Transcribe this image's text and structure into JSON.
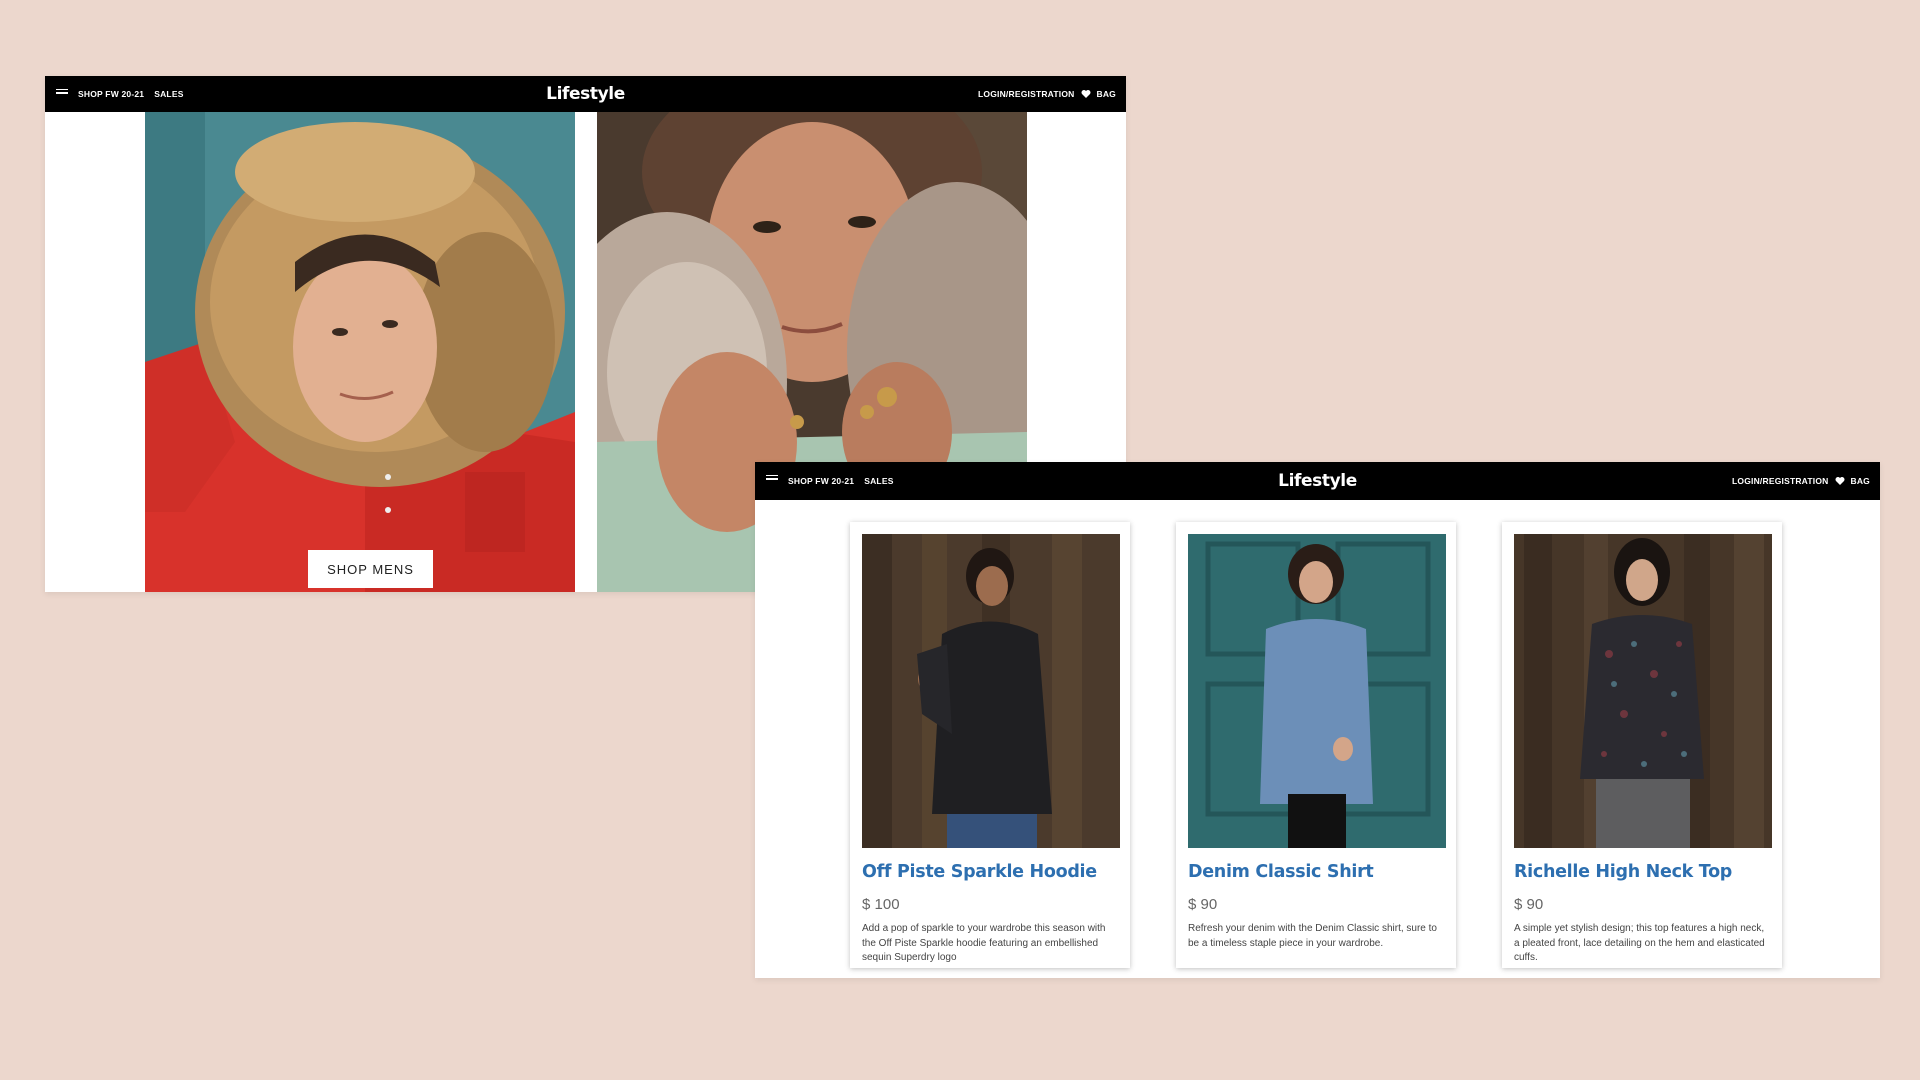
{
  "header": {
    "nav_shop": "SHOP FW 20-21",
    "nav_sales": "SALES",
    "brand": "Lifestyle",
    "login": "LOGIN/REGISTRATION",
    "bag": "BAG",
    "menu_icon": "hamburger-menu-icon",
    "heart_icon": "heart-icon"
  },
  "hero": {
    "shop_button": "SHOP MENS"
  },
  "products": [
    {
      "title": "Off Piste Sparkle Hoodie",
      "price": "$ 100",
      "description": "Add a pop of sparkle to your wardrobe this season with the Off Piste Sparkle hoodie featuring an embellished sequin Superdry logo"
    },
    {
      "title": "Denim Classic Shirt",
      "price": "$ 90",
      "description": "Refresh your denim with the Denim Classic shirt, sure to be a timeless staple piece in your wardrobe."
    },
    {
      "title": "Richelle High Neck Top",
      "price": "$ 90",
      "description": "A simple yet stylish design; this top features a high neck, a pleated front, lace detailing on the hem and elasticated cuffs."
    }
  ],
  "colors": {
    "background": "#ecd7cd",
    "topbar": "#000000",
    "product_title": "#2d6fb0",
    "red_jacket": "#d8322b",
    "teal_wall": "#3f7f86"
  }
}
